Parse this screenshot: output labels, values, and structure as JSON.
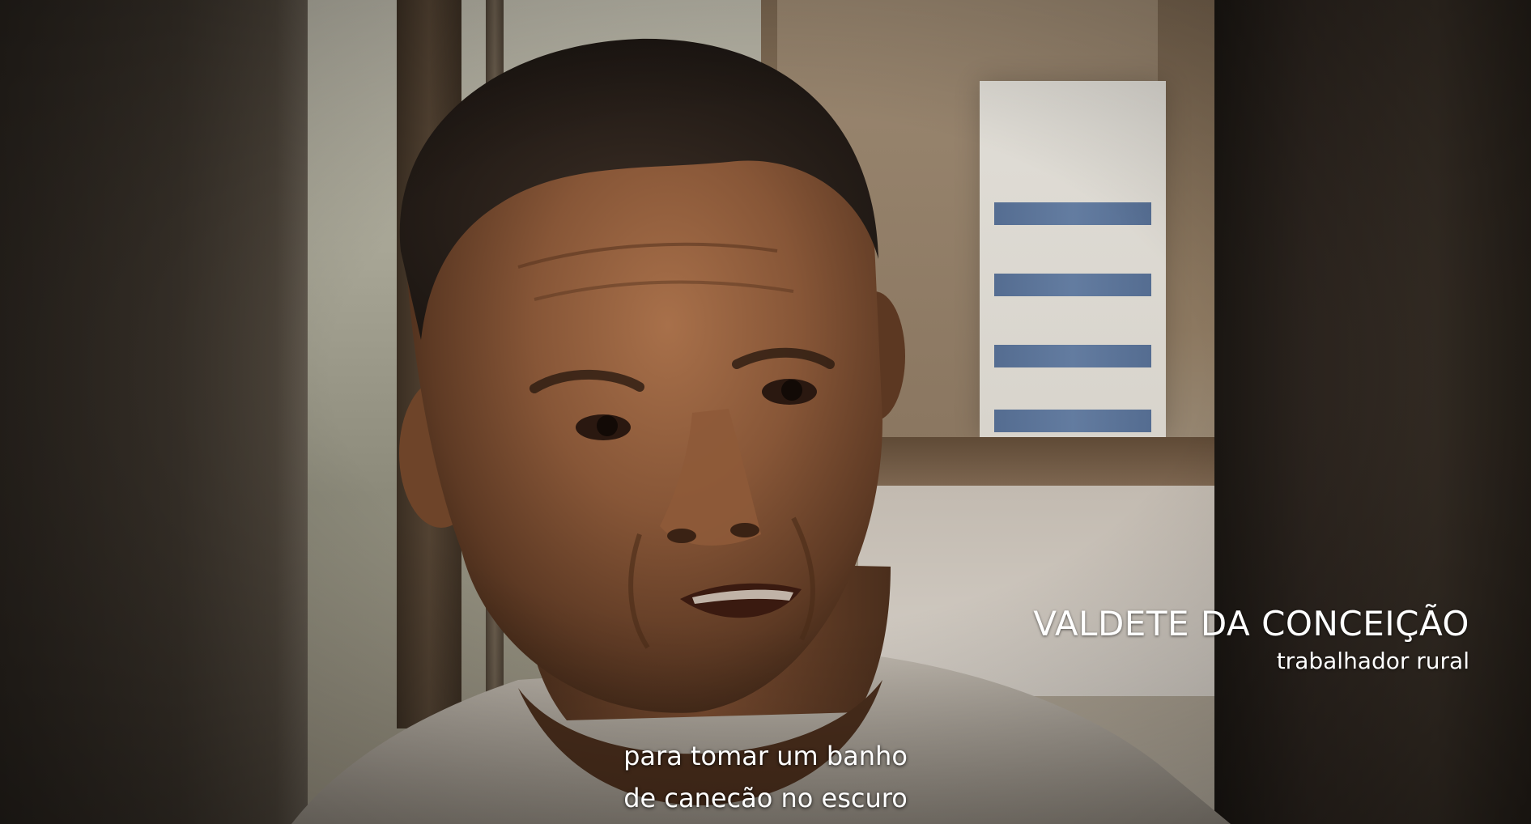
{
  "lower_third": {
    "name": "VALDETE DA CONCEIÇÃO",
    "role": "trabalhador rural"
  },
  "subtitle": {
    "line1": "para tomar um banho",
    "line2": "de canecão no escuro"
  }
}
